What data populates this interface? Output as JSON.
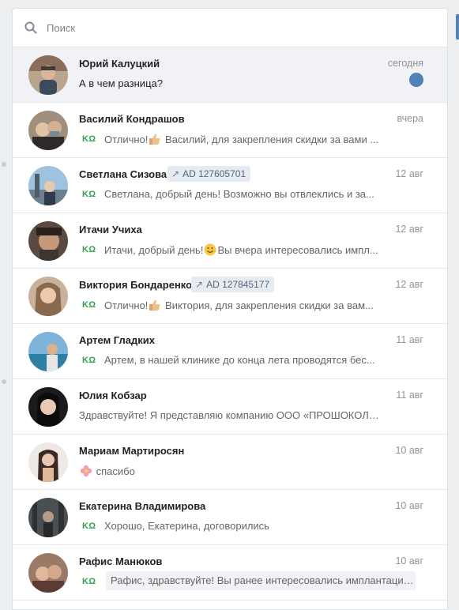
{
  "search": {
    "placeholder": "Поиск",
    "icon": "search-icon"
  },
  "colors": {
    "accent": "#5181b8",
    "unread_bg": "#f0f2f5",
    "brand_logo": "#2da44e"
  },
  "brand_logo_text": "KΩ",
  "dialogs": [
    {
      "name": "Юрий Калуцкий",
      "date": "сегодня",
      "preview": "А в чем разница?",
      "unread": true
    },
    {
      "name": "Василий Кондрашов",
      "date": "вчера",
      "preview_a": "Отлично!",
      "preview_b": " Василий, для закрепления скидки за вами ...",
      "emoji": "thumbs-up"
    },
    {
      "name": "Светлана Сизова",
      "ad": "AD 127605701",
      "date": "12 авг",
      "preview": "Светлана, добрый день! Возможно вы отвлеклись и за..."
    },
    {
      "name": "Итачи Учиха",
      "date": "12 авг",
      "preview_a": "Итачи, добрый день!",
      "preview_b": "Вы вчера интересовались импл...",
      "emoji": "smile"
    },
    {
      "name": "Виктория Бондаренко",
      "ad": "AD 127845177",
      "date": "12 авг",
      "preview_a": "Отлично!",
      "preview_b": " Виктория, для закрепления скидки за вам...",
      "emoji": "thumbs-up"
    },
    {
      "name": "Артем Гладких",
      "date": "11 авг",
      "preview": "Артем, в нашей клинике до конца лета проводятся бес..."
    },
    {
      "name": "Юлия Кобзар",
      "date": "11 авг",
      "preview": "Здравствуйте! Я представляю компанию ООО «ПРОШОКОЛА..."
    },
    {
      "name": "Мариам Мартиросян",
      "date": "10 авг",
      "preview": "спасибо",
      "emoji": "flower"
    },
    {
      "name": "Екатерина Владимирова",
      "date": "10 авг",
      "preview": "Хорошо, Екатерина, договорились"
    },
    {
      "name": "Рафис Манюков",
      "date": "10 авг",
      "preview": "Рафис, здравствуйте! Вы ранее интересовались имплантацие..."
    }
  ]
}
